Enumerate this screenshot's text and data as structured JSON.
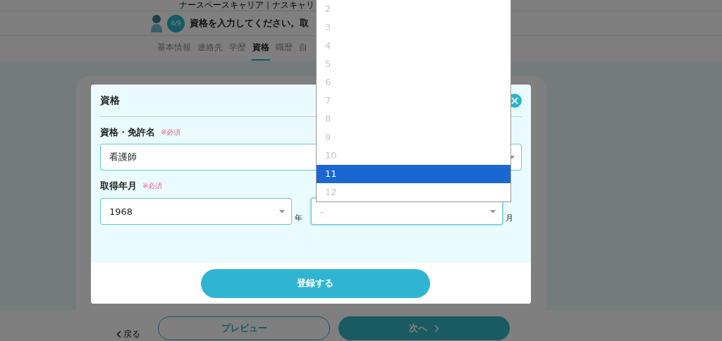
{
  "site_tagline": "ナースペースキャリア｜ナスキャリ",
  "step_badge": "4/9",
  "page_title": "資格を入力してください。取",
  "tabs": [
    {
      "label": "基本情報",
      "selected": false
    },
    {
      "label": "連絡先",
      "selected": false
    },
    {
      "label": "学歴",
      "selected": false
    },
    {
      "label": "資格",
      "selected": true
    },
    {
      "label": "職歴",
      "selected": false
    },
    {
      "label": "自",
      "selected": false
    }
  ],
  "footer": {
    "back_link": "戻る",
    "preview_button": "プレビュー",
    "next_button": "次へ"
  },
  "modal": {
    "title": "資格",
    "name_field": {
      "label": "資格・免許名",
      "required": "※必須",
      "value": "看護師"
    },
    "date_field": {
      "label": "取得年月",
      "required": "※必須",
      "year": {
        "value": "1968",
        "unit": "年",
        "focused": false
      },
      "month": {
        "placeholder": "-",
        "unit": "月",
        "focused": true
      }
    },
    "submit_button": "登録する"
  },
  "month_dropdown": {
    "options": [
      {
        "label": "2",
        "selected": false
      },
      {
        "label": "3",
        "selected": false
      },
      {
        "label": "4",
        "selected": false
      },
      {
        "label": "5",
        "selected": false
      },
      {
        "label": "6",
        "selected": false
      },
      {
        "label": "7",
        "selected": false
      },
      {
        "label": "8",
        "selected": false
      },
      {
        "label": "9",
        "selected": false
      },
      {
        "label": "10",
        "selected": false
      },
      {
        "label": "11",
        "selected": true
      },
      {
        "label": "12",
        "selected": false
      }
    ]
  }
}
